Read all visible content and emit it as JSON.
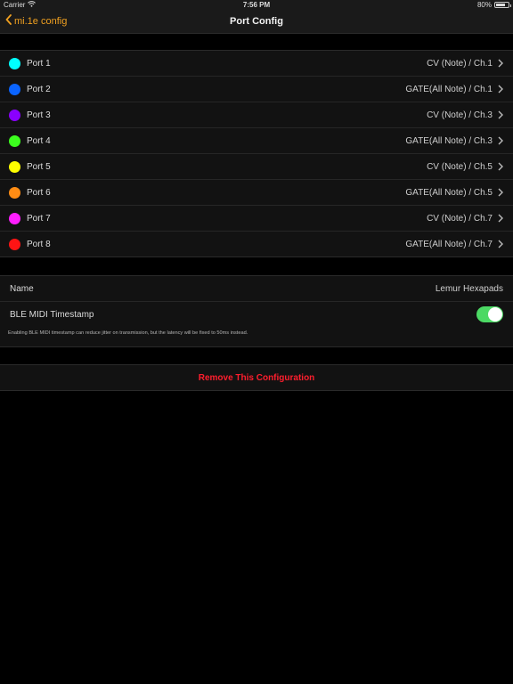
{
  "status_bar": {
    "carrier": "Carrier",
    "time": "7:56 PM",
    "battery": "80%",
    "battery_level": 0.8
  },
  "nav": {
    "back_label": "mi.1e config",
    "title": "Port Config"
  },
  "ports": [
    {
      "label": "Port 1",
      "value": "CV (Note) / Ch.1",
      "color": "#00ffff"
    },
    {
      "label": "Port 2",
      "value": "GATE(All Note) / Ch.1",
      "color": "#0a64ff"
    },
    {
      "label": "Port 3",
      "value": "CV (Note) / Ch.3",
      "color": "#8a00ff"
    },
    {
      "label": "Port 4",
      "value": "GATE(All Note) / Ch.3",
      "color": "#3cff1e"
    },
    {
      "label": "Port 5",
      "value": "CV (Note) / Ch.5",
      "color": "#ffff00"
    },
    {
      "label": "Port 6",
      "value": "GATE(All Note) / Ch.5",
      "color": "#ff8c14"
    },
    {
      "label": "Port 7",
      "value": "CV (Note) / Ch.7",
      "color": "#ff1eff"
    },
    {
      "label": "Port 8",
      "value": "GATE(All Note) / Ch.7",
      "color": "#ff1414"
    }
  ],
  "settings": {
    "name_label": "Name",
    "name_value": "Lemur Hexapads",
    "timestamp_label": "BLE MIDI Timestamp",
    "timestamp_enabled": true,
    "timestamp_note": "Enabling BLE MIDI timestamp can reduce jitter on transmission, but the latency will be fixed to 50ms instead."
  },
  "actions": {
    "remove_label": "Remove This Configuration"
  },
  "colors": {
    "accent": "#f0a020",
    "toggle_on": "#4cd964",
    "destructive": "#ff1e2d"
  }
}
